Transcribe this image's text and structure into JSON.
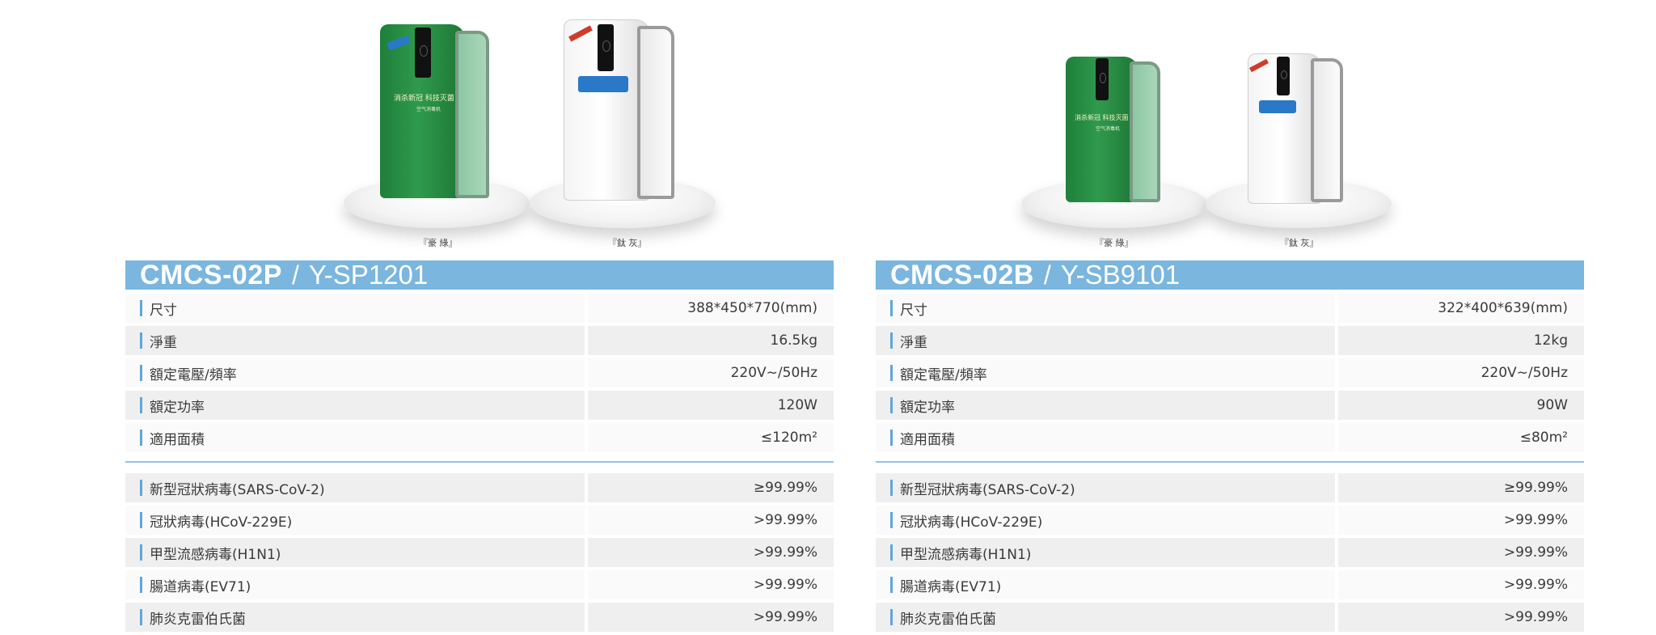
{
  "products": [
    {
      "model": "CMCS-02P",
      "separator": "/",
      "code": "Y-SP1201",
      "slogan": "消杀新冠 科技灭菌",
      "slogan_sub": "空气消毒机",
      "color_labels": [
        "『豪 綠』",
        "『鈦 灰』"
      ],
      "specs": [
        {
          "label": "尺寸",
          "value": "388*450*770(mm)"
        },
        {
          "label": "淨重",
          "value": "16.5kg"
        },
        {
          "label": "額定電壓/頻率",
          "value": "220V~/50Hz"
        },
        {
          "label": "額定功率",
          "value": "120W"
        },
        {
          "label": "適用面積",
          "value": "≤120m²"
        }
      ],
      "tests": [
        {
          "label": "新型冠狀病毒(SARS-CoV-2)",
          "value": "≥99.99%"
        },
        {
          "label": "冠狀病毒(HCoV-229E)",
          "value": ">99.99%"
        },
        {
          "label": "甲型流感病毒(H1N1)",
          "value": ">99.99%"
        },
        {
          "label": "腸道病毒(EV71)",
          "value": ">99.99%"
        },
        {
          "label": "肺炎克雷伯氏菌",
          "value": ">99.99%"
        }
      ]
    },
    {
      "model": "CMCS-02B",
      "separator": "/",
      "code": "Y-SB9101",
      "slogan": "消杀新冠 科技灭菌",
      "slogan_sub": "空气消毒机",
      "color_labels": [
        "『豪 綠』",
        "『鈦 灰』"
      ],
      "specs": [
        {
          "label": "尺寸",
          "value": "322*400*639(mm)"
        },
        {
          "label": "淨重",
          "value": "12kg"
        },
        {
          "label": "額定電壓/頻率",
          "value": "220V~/50Hz"
        },
        {
          "label": "額定功率",
          "value": "90W"
        },
        {
          "label": "適用面積",
          "value": "≤80m²"
        }
      ],
      "tests": [
        {
          "label": "新型冠狀病毒(SARS-CoV-2)",
          "value": "≥99.99%"
        },
        {
          "label": "冠狀病毒(HCoV-229E)",
          "value": ">99.99%"
        },
        {
          "label": "甲型流感病毒(H1N1)",
          "value": ">99.99%"
        },
        {
          "label": "腸道病毒(EV71)",
          "value": ">99.99%"
        },
        {
          "label": "肺炎克雷伯氏菌",
          "value": ">99.99%"
        }
      ]
    }
  ],
  "colors": {
    "header_bar": "#7ab6de",
    "marker": "#5fa7d8",
    "green_unit": "#2f9a4c",
    "row_light": "#fafafa",
    "row_dark": "#efefef"
  }
}
